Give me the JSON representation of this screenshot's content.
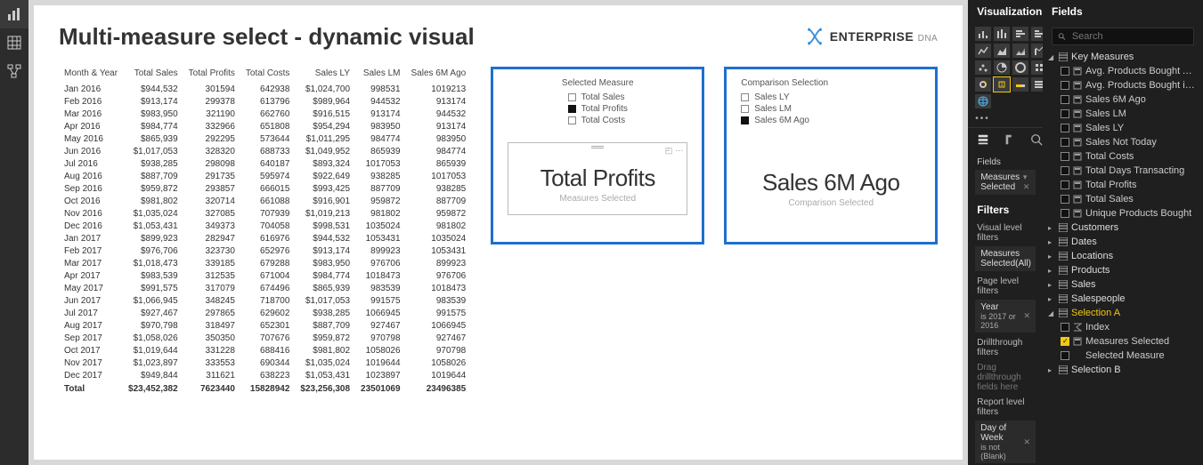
{
  "page_title": "Multi-measure select - dynamic visual",
  "logo": {
    "main": "ENTERPRISE",
    "sub": "DNA"
  },
  "table": {
    "headers": [
      "Month & Year",
      "Total Sales",
      "Total Profits",
      "Total Costs",
      "Sales LY",
      "Sales LM",
      "Sales 6M Ago"
    ],
    "rows": [
      [
        "Jan 2016",
        "$944,532",
        "301594",
        "642938",
        "$1,024,700",
        "998531",
        "1019213"
      ],
      [
        "Feb 2016",
        "$913,174",
        "299378",
        "613796",
        "$989,964",
        "944532",
        "913174"
      ],
      [
        "Mar 2016",
        "$983,950",
        "321190",
        "662760",
        "$916,515",
        "913174",
        "944532"
      ],
      [
        "Apr 2016",
        "$984,774",
        "332966",
        "651808",
        "$954,294",
        "983950",
        "913174"
      ],
      [
        "May 2016",
        "$865,939",
        "292295",
        "573644",
        "$1,011,295",
        "984774",
        "983950"
      ],
      [
        "Jun 2016",
        "$1,017,053",
        "328320",
        "688733",
        "$1,049,952",
        "865939",
        "984774"
      ],
      [
        "Jul 2016",
        "$938,285",
        "298098",
        "640187",
        "$893,324",
        "1017053",
        "865939"
      ],
      [
        "Aug 2016",
        "$887,709",
        "291735",
        "595974",
        "$922,649",
        "938285",
        "1017053"
      ],
      [
        "Sep 2016",
        "$959,872",
        "293857",
        "666015",
        "$993,425",
        "887709",
        "938285"
      ],
      [
        "Oct 2016",
        "$981,802",
        "320714",
        "661088",
        "$916,901",
        "959872",
        "887709"
      ],
      [
        "Nov 2016",
        "$1,035,024",
        "327085",
        "707939",
        "$1,019,213",
        "981802",
        "959872"
      ],
      [
        "Dec 2016",
        "$1,053,431",
        "349373",
        "704058",
        "$998,531",
        "1035024",
        "981802"
      ],
      [
        "Jan 2017",
        "$899,923",
        "282947",
        "616976",
        "$944,532",
        "1053431",
        "1035024"
      ],
      [
        "Feb 2017",
        "$976,706",
        "323730",
        "652976",
        "$913,174",
        "899923",
        "1053431"
      ],
      [
        "Mar 2017",
        "$1,018,473",
        "339185",
        "679288",
        "$983,950",
        "976706",
        "899923"
      ],
      [
        "Apr 2017",
        "$983,539",
        "312535",
        "671004",
        "$984,774",
        "1018473",
        "976706"
      ],
      [
        "May 2017",
        "$991,575",
        "317079",
        "674496",
        "$865,939",
        "983539",
        "1018473"
      ],
      [
        "Jun 2017",
        "$1,066,945",
        "348245",
        "718700",
        "$1,017,053",
        "991575",
        "983539"
      ],
      [
        "Jul 2017",
        "$927,467",
        "297865",
        "629602",
        "$938,285",
        "1066945",
        "991575"
      ],
      [
        "Aug 2017",
        "$970,798",
        "318497",
        "652301",
        "$887,709",
        "927467",
        "1066945"
      ],
      [
        "Sep 2017",
        "$1,058,026",
        "350350",
        "707676",
        "$959,872",
        "970798",
        "927467"
      ],
      [
        "Oct 2017",
        "$1,019,644",
        "331228",
        "688416",
        "$981,802",
        "1058026",
        "970798"
      ],
      [
        "Nov 2017",
        "$1,023,897",
        "333553",
        "690344",
        "$1,035,024",
        "1019644",
        "1058026"
      ],
      [
        "Dec 2017",
        "$949,844",
        "311621",
        "638223",
        "$1,053,431",
        "1023897",
        "1019644"
      ]
    ],
    "total": [
      "Total",
      "$23,452,382",
      "7623440",
      "15828942",
      "$23,256,308",
      "23501069",
      "23496385"
    ]
  },
  "card1": {
    "title": "Selected Measure",
    "options": [
      {
        "label": "Total Sales",
        "selected": false
      },
      {
        "label": "Total Profits",
        "selected": true
      },
      {
        "label": "Total Costs",
        "selected": false
      }
    ],
    "big": "Total Profits",
    "sub": "Measures Selected"
  },
  "card2": {
    "title": "Comparison Selection",
    "options": [
      {
        "label": "Sales LY",
        "selected": false
      },
      {
        "label": "Sales LM",
        "selected": false
      },
      {
        "label": "Sales 6M Ago",
        "selected": true
      }
    ],
    "big": "Sales 6M Ago",
    "sub": "Comparison Selected"
  },
  "viz_pane": {
    "title": "Visualizations",
    "fields_label": "Fields",
    "well": "Measures Selected",
    "filters_title": "Filters",
    "visual_level": "Visual level filters",
    "visual_filter": "Measures Selected(All)",
    "page_level": "Page level filters",
    "page_filter_label": "Year",
    "page_filter_value": "is 2017 or 2016",
    "drill_label": "Drillthrough filters",
    "drill_hint": "Drag drillthrough fields here",
    "report_level": "Report level filters",
    "report_filter_label": "Day of Week",
    "report_filter_value": "is not (Blank)"
  },
  "fields_pane": {
    "title": "Fields",
    "search_placeholder": "Search",
    "tables": [
      {
        "name": "Key Measures",
        "expanded": true,
        "fields": [
          {
            "name": "Avg. Products Bought A...",
            "type": "measure"
          },
          {
            "name": "Avg. Products Bought in...",
            "type": "measure"
          },
          {
            "name": "Sales 6M Ago",
            "type": "measure"
          },
          {
            "name": "Sales LM",
            "type": "measure"
          },
          {
            "name": "Sales LY",
            "type": "measure"
          },
          {
            "name": "Sales Not Today",
            "type": "measure"
          },
          {
            "name": "Total Costs",
            "type": "measure"
          },
          {
            "name": "Total Days Transacting",
            "type": "measure"
          },
          {
            "name": "Total Profits",
            "type": "measure"
          },
          {
            "name": "Total Sales",
            "type": "measure"
          },
          {
            "name": "Unique Products Bought",
            "type": "measure"
          }
        ]
      },
      {
        "name": "Customers",
        "expanded": false
      },
      {
        "name": "Dates",
        "expanded": false
      },
      {
        "name": "Locations",
        "expanded": false
      },
      {
        "name": "Products",
        "expanded": false
      },
      {
        "name": "Sales",
        "expanded": false
      },
      {
        "name": "Salespeople",
        "expanded": false
      },
      {
        "name": "Selection A",
        "expanded": true,
        "selected": true,
        "fields": [
          {
            "name": "Index",
            "type": "sum"
          },
          {
            "name": "Measures Selected",
            "type": "measure",
            "checked": true
          },
          {
            "name": "Selected Measure",
            "type": "col"
          }
        ]
      },
      {
        "name": "Selection B",
        "expanded": false
      }
    ]
  }
}
